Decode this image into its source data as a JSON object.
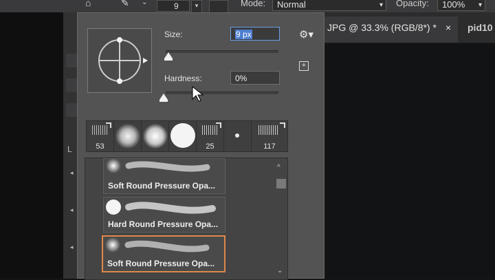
{
  "options_bar": {
    "size_value": "9",
    "mode_label": "Mode:",
    "mode_value": "Normal",
    "opacity_label": "Opacity:",
    "opacity_value": "100%"
  },
  "document_tabs": [
    {
      "label": "JPG @ 33.3% (RGB/8*) *",
      "close": "×"
    },
    {
      "label": "pid10"
    }
  ],
  "tool_column": {
    "letter": "L"
  },
  "brush_panel": {
    "size_label": "Size:",
    "size_value": "9 px",
    "hardness_label": "Hardness:",
    "hardness_value": "0%",
    "size_slider": 0.02,
    "hardness_slider": 0.0,
    "tips": [
      "53",
      "",
      "",
      "",
      "25",
      "",
      "117"
    ],
    "presets": [
      {
        "label": "Soft Round Pressure Opa...",
        "selected": false
      },
      {
        "label": "Hard Round Pressure Opa...",
        "selected": false
      },
      {
        "label": "Soft Round Pressure Opa...",
        "selected": true
      }
    ]
  },
  "colors": {
    "accent_selection": "#e0884a",
    "field_highlight": "#4e7fd0"
  }
}
